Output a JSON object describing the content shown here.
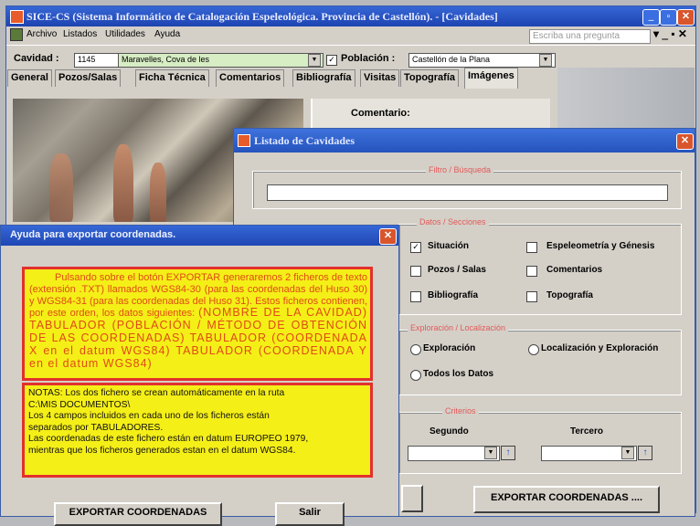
{
  "app": {
    "title": "SICE-CS (Sistema Informático de Catalogación Espeleológica.  Provincia de Castellón).  - [Cavidades]"
  },
  "menu": {
    "items": [
      "Archivo",
      "Listados",
      "Utilidades",
      "Ayuda"
    ],
    "ask_placeholder": "Escriba una pregunta"
  },
  "toolbar": {
    "cavidad_label": "Cavidad :",
    "cavidad_id": "1145",
    "cavidad_name": "Maravelles, Cova de les",
    "poblacion_label": "Población :",
    "poblacion_value": "Castellón de la Plana"
  },
  "tabs": [
    "General",
    "Pozos/Salas",
    "Ficha Técnica",
    "Comentarios",
    "Bibliografía",
    "Visitas",
    "Topografía",
    "Imágenes"
  ],
  "active_tab": "Imágenes",
  "comentario_label": "Comentario:",
  "listado": {
    "title": "Listado de Cavidades",
    "group1_label": "Filtro / Búsqueda",
    "group2_label": "Datos / Secciones",
    "checks": [
      {
        "label": "Situación",
        "checked": true
      },
      {
        "label": "Espeleometría y Génesis",
        "checked": false
      },
      {
        "label": "Pozos / Salas",
        "checked": false
      },
      {
        "label": "Comentarios",
        "checked": false
      },
      {
        "label": "Bibliografía",
        "checked": false
      },
      {
        "label": "Topografía",
        "checked": false
      }
    ],
    "group3_label": "Exploración / Localización",
    "checks2": [
      {
        "label": "Exploración"
      },
      {
        "label": "Localización y Exploración"
      },
      {
        "label": "Todos los Datos"
      }
    ],
    "group4_label": "Criterios",
    "segundo_label": "Segundo",
    "tercero_label": "Tercero",
    "export_button": "EXPORTAR COORDENADAS ...."
  },
  "ayuda": {
    "title": "Ayuda para exportar coordenadas.",
    "para1": "Pulsando sobre el botón EXPORTAR generaremos 2 ficheros de texto (extensión .TXT) llamados WGS84-30 (para las coordenadas del Huso 30) y WGS84-31 (para las coordenadas del Huso 31). Estos ficheros contienen, por este orden, los datos siguientes:",
    "para1_big": "(NOMBRE DE LA CAVIDAD) TABULADOR (POBLACIÓN / MÉTODO DE OBTENCIÓN DE LAS COORDENADAS) TABULADOR (COORDENADA X en el datum WGS84) TABULADOR (COORDENADA  Y  en el datum WGS84)",
    "notas": [
      "NOTAS:   Los dos fichero se crean automáticamente en la ruta",
      "C:\\MIS DOCUMENTOS\\",
      "Los 4 campos incluidos en cada uno de los ficheros están",
      "separados por TABULADORES.",
      "Las coordenadas de este fichero están en datum EUROPEO 1979,",
      "mientras que los ficheros generados estan en el datum WGS84."
    ],
    "export_button": "EXPORTAR COORDENADAS",
    "salir_button": "Salir"
  }
}
